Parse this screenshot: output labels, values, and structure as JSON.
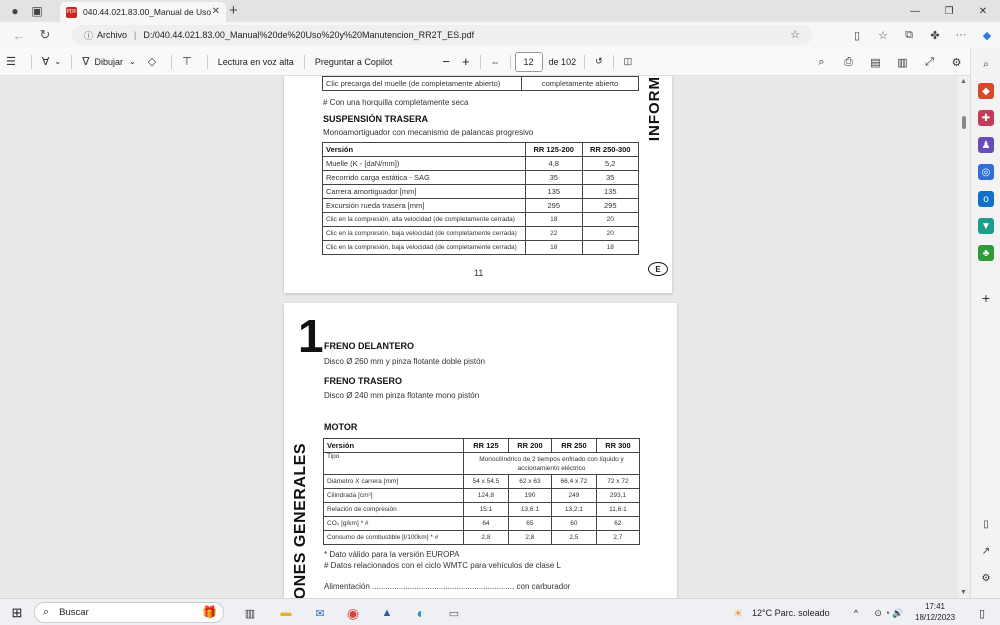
{
  "browser": {
    "tab_title": "040.44.021.83.00_Manual de Uso",
    "tab_badge": "PDF",
    "url_label": "Archivo",
    "url": "D:/040.44.021.83.00_Manual%20de%20Uso%20y%20Manutencion_RR2T_ES.pdf"
  },
  "pdf_toolbar": {
    "draw_label": "Dibujar",
    "read_aloud_label": "Lectura en voz alta",
    "copilot_label": "Preguntar a Copilot",
    "page_current": "12",
    "page_total": "de 102"
  },
  "page1": {
    "clic_row": {
      "label": "Clic precarga del muelle (de completamente abierto)",
      "value": "completamente abierto"
    },
    "footnote": "# Con una horquilla completamente seca",
    "section_title": "SUSPENSIÓN TRASERA",
    "section_sub": "Monoamortiguador con mecanismo de palancas progresivo",
    "table": {
      "headers": [
        "Versión",
        "RR 125-200",
        "RR 250-300"
      ],
      "rows": [
        [
          "Muelle (K - [daN/mm])",
          "4,8",
          "5,2"
        ],
        [
          "Recorrido carga estática - SAG",
          "35",
          "35"
        ],
        [
          "Carrera amortiguador [mm]",
          "135",
          "135"
        ],
        [
          "Excursión rueda trasera [mm]",
          "295",
          "295"
        ],
        [
          "Clic en la compresión, alta velocidad (de completamente cerrada)",
          "18",
          "20"
        ],
        [
          "Clic en la compresión, baja velocidad (de completamente cerrada)",
          "22",
          "20"
        ],
        [
          "Clic en la compresión, baja velocidad (de completamente cerrada)",
          "18",
          "18"
        ]
      ]
    },
    "page_number": "11",
    "side_tab": "INFORM",
    "lang_badge": "E"
  },
  "page2": {
    "chapter_number": "1",
    "side_tab": "ONES GENERALES",
    "front_brake_title": "FRENO DELANTERO",
    "front_brake_text": "Disco Ø 260 mm y pinza flotante doble pistón",
    "rear_brake_title": "FRENO TRASERO",
    "rear_brake_text": "Disco Ø 240 mm pinza flotante mono pistón",
    "motor_title": "MOTOR",
    "motor_table": {
      "headers": [
        "Versión",
        "RR 125",
        "RR 200",
        "RR 250",
        "RR 300"
      ],
      "tipo_label": "Tipo",
      "tipo_value": "Monocilíndrico de 2 tiempos enfriado con líquido y accionamiento eléctrico",
      "rows": [
        [
          "Diámetro X carrera [mm]",
          "54 x 54,5",
          "62 x 63",
          "66,4 x 72",
          "72 x 72"
        ],
        [
          "Cilindrada [cm³]",
          "124,8",
          "190",
          "249",
          "293,1"
        ],
        [
          "Relación de compresión",
          "15:1",
          "13,6:1",
          "13,2:1",
          "11,6:1"
        ],
        [
          "CO₂ [g/km] * #",
          "64",
          "65",
          "60",
          "62"
        ],
        [
          "Consumo de combustible [l/100km] * #",
          "2,8",
          "2,8",
          "2,5",
          "2,7"
        ]
      ]
    },
    "note1": "* Dato válido para la versión EUROPA",
    "note2": "# Datos relacionados con el ciclo WMTC para vehículos de clase L",
    "alimentacion": "Alimentación ................................................................ con carburador"
  },
  "taskbar": {
    "search_placeholder": "Buscar",
    "weather": "12°C  Parc. soleado",
    "time": "17:41",
    "date": "18/12/2023"
  }
}
